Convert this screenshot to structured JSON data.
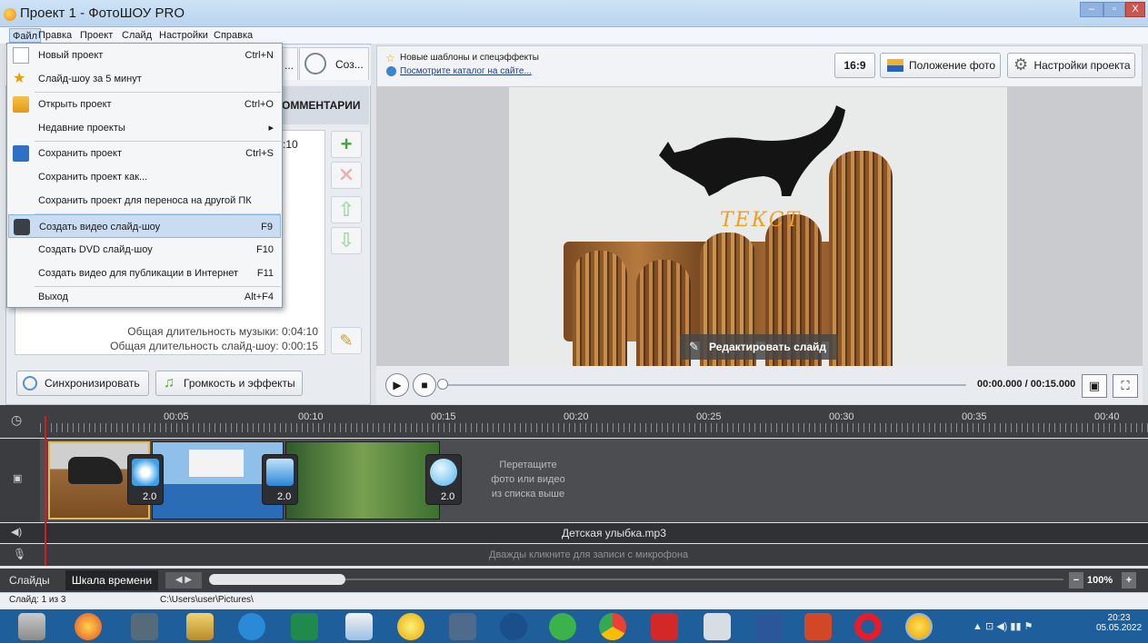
{
  "window": {
    "title": "Проект 1 - ФотоШОУ PRO"
  },
  "menubar": {
    "items": [
      "Файл",
      "Правка",
      "Проект",
      "Слайд",
      "Настройки",
      "Справка"
    ]
  },
  "file_menu": {
    "items": [
      {
        "label": "Новый проект",
        "shortcut": "Ctrl+N"
      },
      {
        "label": "Слайд-шоу за 5 минут",
        "shortcut": ""
      },
      {
        "label": "Открыть проект",
        "shortcut": "Ctrl+O"
      },
      {
        "label": "Недавние проекты",
        "shortcut": "▸"
      },
      {
        "label": "Сохранить проект",
        "shortcut": "Ctrl+S"
      },
      {
        "label": "Сохранить проект как...",
        "shortcut": ""
      },
      {
        "label": "Сохранить проект для переноса на другой ПК",
        "shortcut": ""
      },
      {
        "label": "Создать видео слайд-шоу",
        "shortcut": "F9"
      },
      {
        "label": "Создать DVD слайд-шоу",
        "shortcut": "F10"
      },
      {
        "label": "Создать видео для публикации в Интернет",
        "shortcut": "F11"
      },
      {
        "label": "Выход",
        "shortcut": "Alt+F4"
      }
    ]
  },
  "left_panel": {
    "tab_partial": "...",
    "tab2_label": "Соз...",
    "comments_header": "ОММЕНТАРИИ",
    "music_time_partial": ":10",
    "music_total": "Общая длительность музыки: 0:04:10",
    "show_total": "Общая длительность слайд-шоу: 0:00:15",
    "sync_button": "Синхронизировать",
    "volume_button": "Громкость и эффекты"
  },
  "right_panel": {
    "new_templates": "Новые шаблоны и спецэффекты",
    "catalog_link": "Посмотрите каталог на сайте...",
    "aspect_button": "16:9",
    "photo_position_button": "Положение фото",
    "project_settings_button": "Настройки проекта",
    "slide_text": "ТЕКСТ",
    "edit_slide_button": "Редактировать слайд",
    "time_readout": "00:00.000 / 00:15.000"
  },
  "timeline": {
    "ticks": [
      "00:05",
      "00:10",
      "00:15",
      "00:20",
      "00:25",
      "00:30",
      "00:35",
      "00:40"
    ],
    "transitions": [
      "2.0",
      "2.0",
      "2.0"
    ],
    "drop_hint_1": "Перетащите",
    "drop_hint_2": "фото или видео",
    "drop_hint_3": "из списка выше",
    "audio_file": "Детская улыбка.mp3",
    "mic_hint": "Дважды кликните для записи с микрофона",
    "tab_slides": "Слайды",
    "tab_timeline": "Шкала времени",
    "zoom": "100%"
  },
  "status": {
    "slide_info": "Слайд: 1 из 3",
    "path": "C:\\Users\\user\\Pictures\\"
  },
  "taskbar": {
    "time": "20:23",
    "date": "05.05.2022"
  }
}
